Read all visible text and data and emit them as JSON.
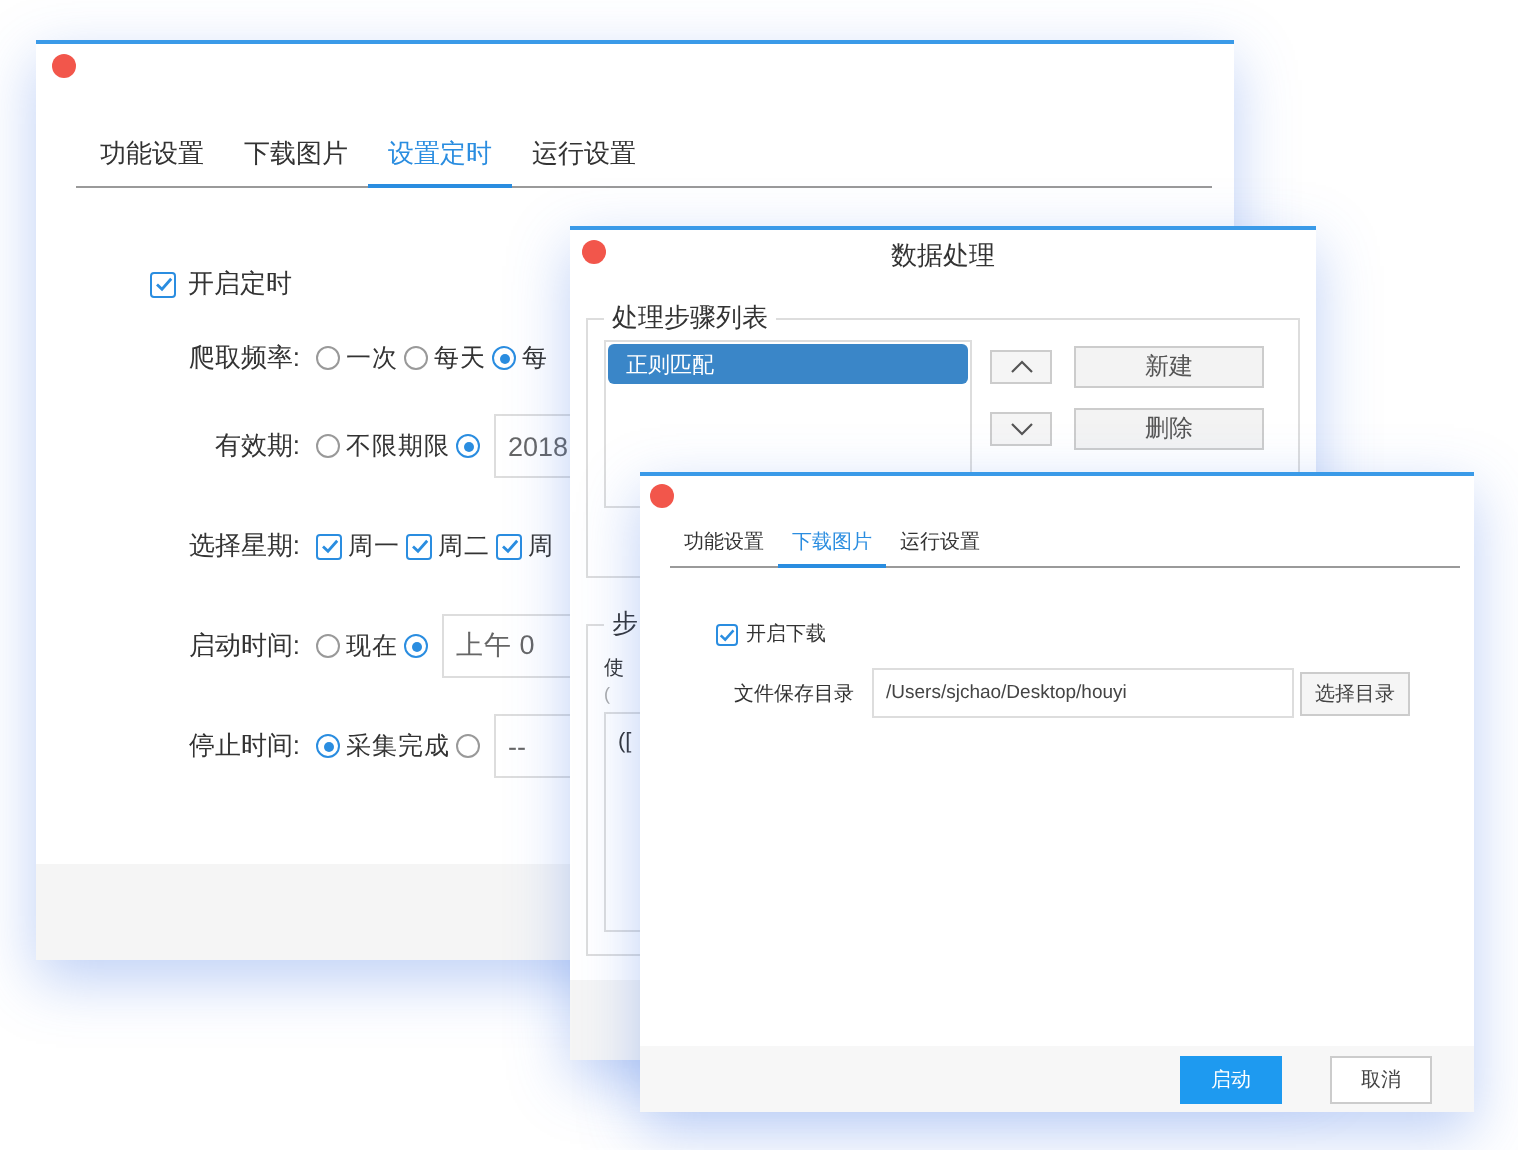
{
  "settings_window": {
    "tabs": [
      {
        "label": "功能设置",
        "selected": false
      },
      {
        "label": "下载图片",
        "selected": false
      },
      {
        "label": "设置定时",
        "selected": true
      },
      {
        "label": "运行设置",
        "selected": false
      }
    ],
    "schedule_toggle": {
      "label": "开启定时",
      "checked": true
    },
    "rows": [
      {
        "label": "爬取频率:",
        "kind": "radio",
        "options": [
          {
            "label": "一次",
            "selected": false
          },
          {
            "label": "每天",
            "selected": false
          },
          {
            "label": "每",
            "selected": true
          }
        ]
      },
      {
        "label": "有效期:",
        "kind": "radio",
        "options": [
          {
            "label": "不限期限",
            "selected": false
          },
          {
            "selected": true
          }
        ],
        "field": {
          "value": "2018"
        }
      },
      {
        "label": "选择星期:",
        "kind": "checkbox",
        "options": [
          {
            "label": "周一",
            "checked": true
          },
          {
            "label": "周二",
            "checked": true
          },
          {
            "label": "周",
            "checked": true
          }
        ]
      },
      {
        "label": "启动时间:",
        "kind": "radio",
        "options": [
          {
            "label": "现在",
            "selected": false
          },
          {
            "selected": true
          }
        ],
        "field": {
          "value": "上午 0"
        }
      },
      {
        "label": "停止时间:",
        "kind": "radio",
        "options": [
          {
            "label": "采集完成",
            "selected": true
          },
          {
            "selected": false
          }
        ],
        "field": {
          "value": "--"
        }
      }
    ]
  },
  "processing_window": {
    "title": "数据处理",
    "steps_group": {
      "title": "处理步骤列表",
      "steps": [
        {
          "label": "正则匹配",
          "selected": true
        }
      ],
      "move_buttons": [
        {
          "kind": "up"
        },
        {
          "kind": "down"
        }
      ],
      "action_buttons": [
        {
          "label": "新建"
        },
        {
          "label": "删除"
        }
      ]
    },
    "step_group": {
      "title": "步",
      "description": "使",
      "hint": "(",
      "editor": {
        "value": "(["
      }
    }
  },
  "download_window": {
    "tabs": [
      {
        "label": "功能设置",
        "selected": false
      },
      {
        "label": "下载图片",
        "selected": true
      },
      {
        "label": "运行设置",
        "selected": false
      }
    ],
    "download_toggle": {
      "label": "开启下载",
      "checked": true
    },
    "save_directory": {
      "label": "文件保存目录",
      "value": "/Users/sjchao/Desktop/houyi",
      "button": "选择目录"
    },
    "footer_buttons": [
      {
        "label": "启动",
        "kind": "primary"
      },
      {
        "label": "取消",
        "kind": "default"
      }
    ]
  }
}
